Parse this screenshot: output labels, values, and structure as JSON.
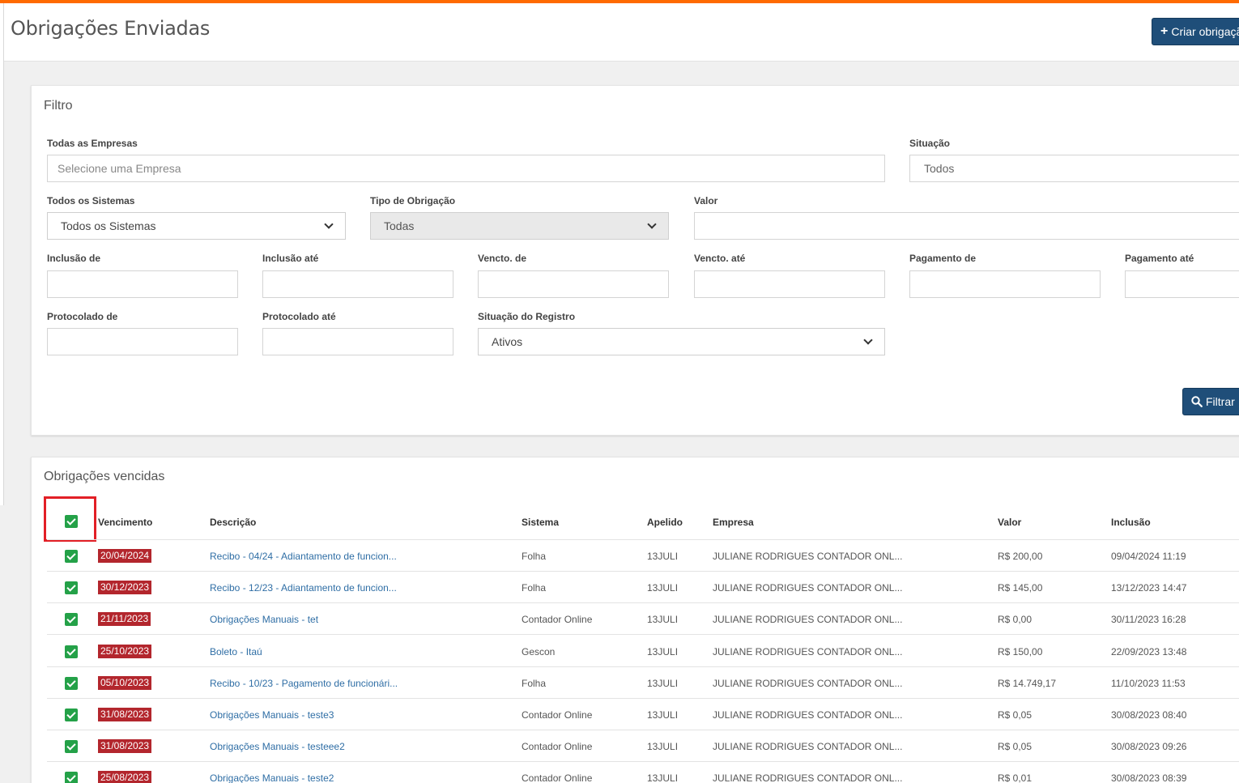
{
  "header": {
    "title": "Obrigações Enviadas",
    "create_label": "Criar obrigação"
  },
  "filter": {
    "title": "Filtro",
    "empresas_label": "Todas as Empresas",
    "empresas_placeholder": "Selecione uma Empresa",
    "situacao_label": "Situação",
    "situacao_value": "Todos",
    "sistemas_label": "Todos os Sistemas",
    "sistemas_value": "Todos os Sistemas",
    "tipo_label": "Tipo de Obrigação",
    "tipo_value": "Todas",
    "valor_label": "Valor",
    "inclusao_de_label": "Inclusão de",
    "inclusao_ate_label": "Inclusão até",
    "vencto_de_label": "Vencto. de",
    "vencto_ate_label": "Vencto. até",
    "pagamento_de_label": "Pagamento de",
    "pagamento_ate_label": "Pagamento até",
    "protocolado_de_label": "Protocolado de",
    "protocolado_ate_label": "Protocolado até",
    "situacao_registro_label": "Situação do Registro",
    "situacao_registro_value": "Ativos",
    "filter_button_label": "Filtrar"
  },
  "table": {
    "title": "Obrigações vencidas",
    "columns": [
      "Vencimento",
      "Descrição",
      "Sistema",
      "Apelido",
      "Empresa",
      "Valor",
      "Inclusão"
    ],
    "rows": [
      {
        "vencimento": "20/04/2024",
        "descricao": "Recibo - 04/24 - Adiantamento de funcion...",
        "sistema": "Folha",
        "apelido": "13JULI",
        "empresa": "JULIANE RODRIGUES CONTADOR ONL...",
        "valor": "R$ 200,00",
        "inclusao": "09/04/2024 11:19"
      },
      {
        "vencimento": "30/12/2023",
        "descricao": "Recibo - 12/23 - Adiantamento de funcion...",
        "sistema": "Folha",
        "apelido": "13JULI",
        "empresa": "JULIANE RODRIGUES CONTADOR ONL...",
        "valor": "R$ 145,00",
        "inclusao": "13/12/2023 14:47"
      },
      {
        "vencimento": "21/11/2023",
        "descricao": "Obrigações Manuais - tet",
        "sistema": "Contador Online",
        "apelido": "13JULI",
        "empresa": "JULIANE RODRIGUES CONTADOR ONL...",
        "valor": "R$ 0,00",
        "inclusao": "30/11/2023 16:28"
      },
      {
        "vencimento": "25/10/2023",
        "descricao": "Boleto - Itaú",
        "sistema": "Gescon",
        "apelido": "13JULI",
        "empresa": "JULIANE RODRIGUES CONTADOR ONL...",
        "valor": "R$ 150,00",
        "inclusao": "22/09/2023 13:48"
      },
      {
        "vencimento": "05/10/2023",
        "descricao": "Recibo - 10/23 - Pagamento de funcionári...",
        "sistema": "Folha",
        "apelido": "13JULI",
        "empresa": "JULIANE RODRIGUES CONTADOR ONL...",
        "valor": "R$ 14.749,17",
        "inclusao": "11/10/2023 11:53"
      },
      {
        "vencimento": "31/08/2023",
        "descricao": "Obrigações Manuais - teste3",
        "sistema": "Contador Online",
        "apelido": "13JULI",
        "empresa": "JULIANE RODRIGUES CONTADOR ONL...",
        "valor": "R$ 0,05",
        "inclusao": "30/08/2023 08:40"
      },
      {
        "vencimento": "31/08/2023",
        "descricao": "Obrigações Manuais - testeee2",
        "sistema": "Contador Online",
        "apelido": "13JULI",
        "empresa": "JULIANE RODRIGUES CONTADOR ONL...",
        "valor": "R$ 0,05",
        "inclusao": "30/08/2023 09:26"
      },
      {
        "vencimento": "25/08/2023",
        "descricao": "Obrigações Manuais - teste2",
        "sistema": "Contador Online",
        "apelido": "13JULI",
        "empresa": "JULIANE RODRIGUES CONTADOR ONL...",
        "valor": "R$ 0,01",
        "inclusao": "30/08/2023 08:39"
      }
    ]
  },
  "colors": {
    "accent_bar": "#ff6a00",
    "primary_button": "#1f4e79",
    "overdue_badge": "#b3262d",
    "checkbox": "#24a148",
    "link": "#2f6ea5",
    "highlight": "#e21f26"
  },
  "icons": {
    "create": "plus-icon",
    "filter": "search-icon",
    "checkbox": "check-icon",
    "select": "chevron-down-icon"
  }
}
